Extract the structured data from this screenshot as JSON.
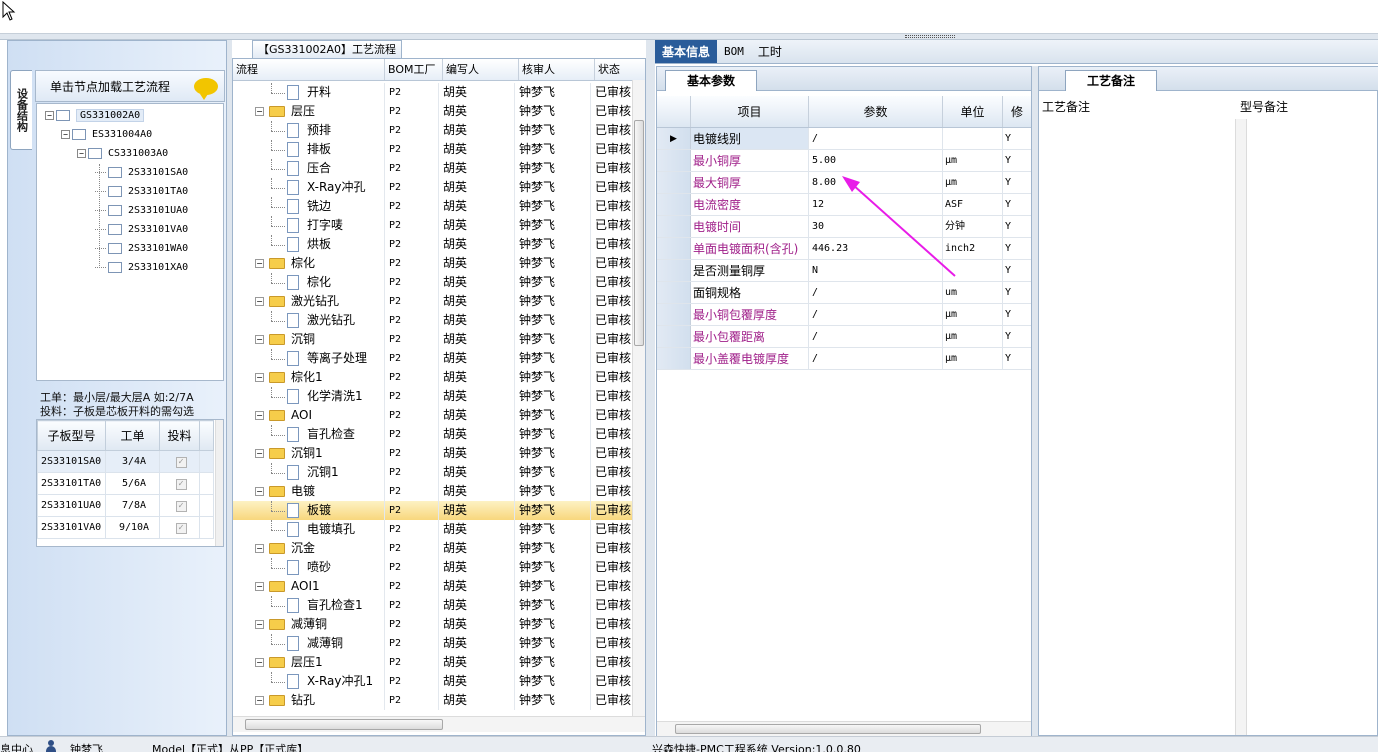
{
  "left": {
    "vtab": "设备结构",
    "header": "单击节点加载工艺流程",
    "tree": [
      {
        "label": "GS331002A0",
        "level": 0,
        "exp": true
      },
      {
        "label": "ES331004A0",
        "level": 1,
        "exp": true
      },
      {
        "label": "CS331003A0",
        "level": 2,
        "exp": true
      },
      {
        "label": "2S33101SA0",
        "level": 3
      },
      {
        "label": "2S33101TA0",
        "level": 3
      },
      {
        "label": "2S33101UA0",
        "level": 3
      },
      {
        "label": "2S33101VA0",
        "level": 3
      },
      {
        "label": "2S33101WA0",
        "level": 3
      },
      {
        "label": "2S33101XA0",
        "level": 3
      }
    ],
    "note1": "工单：最小层/最大层A 如:2/7A",
    "note2": "投料：子板是芯板开料的需勾选",
    "sub_grid": {
      "headers": [
        "子板型号",
        "工单",
        "投料"
      ],
      "rows": [
        [
          "2S33101SA0",
          "3/4A"
        ],
        [
          "2S33101TA0",
          "5/6A"
        ],
        [
          "2S33101UA0",
          "7/8A"
        ],
        [
          "2S33101VA0",
          "9/10A"
        ]
      ]
    }
  },
  "middle": {
    "title": "【GS331002A0】工艺流程",
    "headers": [
      "流程",
      "BOM工厂",
      "编写人",
      "核审人",
      "状态"
    ],
    "rows": [
      {
        "name": "开料",
        "type": "doc",
        "bom": "P2",
        "writer": "胡英",
        "checker": "钟梦飞",
        "status": "已审核"
      },
      {
        "name": "层压",
        "type": "folder",
        "bom": "P2",
        "writer": "胡英",
        "checker": "钟梦飞",
        "status": "已审核"
      },
      {
        "name": "预排",
        "type": "doc",
        "bom": "P2",
        "writer": "胡英",
        "checker": "钟梦飞",
        "status": "已审核"
      },
      {
        "name": "排板",
        "type": "doc",
        "bom": "P2",
        "writer": "胡英",
        "checker": "钟梦飞",
        "status": "已审核"
      },
      {
        "name": "压合",
        "type": "doc",
        "bom": "P2",
        "writer": "胡英",
        "checker": "钟梦飞",
        "status": "已审核"
      },
      {
        "name": "X-Ray冲孔",
        "type": "doc",
        "bom": "P2",
        "writer": "胡英",
        "checker": "钟梦飞",
        "status": "已审核"
      },
      {
        "name": "铣边",
        "type": "doc",
        "bom": "P2",
        "writer": "胡英",
        "checker": "钟梦飞",
        "status": "已审核"
      },
      {
        "name": "打字唛",
        "type": "doc",
        "bom": "P2",
        "writer": "胡英",
        "checker": "钟梦飞",
        "status": "已审核"
      },
      {
        "name": "烘板",
        "type": "doc",
        "bom": "P2",
        "writer": "胡英",
        "checker": "钟梦飞",
        "status": "已审核"
      },
      {
        "name": "棕化",
        "type": "folder",
        "bom": "P2",
        "writer": "胡英",
        "checker": "钟梦飞",
        "status": "已审核"
      },
      {
        "name": "棕化",
        "type": "doc",
        "bom": "P2",
        "writer": "胡英",
        "checker": "钟梦飞",
        "status": "已审核"
      },
      {
        "name": "激光钻孔",
        "type": "folder",
        "bom": "P2",
        "writer": "胡英",
        "checker": "钟梦飞",
        "status": "已审核"
      },
      {
        "name": "激光钻孔",
        "type": "doc",
        "bom": "P2",
        "writer": "胡英",
        "checker": "钟梦飞",
        "status": "已审核"
      },
      {
        "name": "沉铜",
        "type": "folder",
        "bom": "P2",
        "writer": "胡英",
        "checker": "钟梦飞",
        "status": "已审核"
      },
      {
        "name": "等离子处理",
        "type": "doc",
        "bom": "P2",
        "writer": "胡英",
        "checker": "钟梦飞",
        "status": "已审核"
      },
      {
        "name": "棕化1",
        "type": "folder",
        "bom": "P2",
        "writer": "胡英",
        "checker": "钟梦飞",
        "status": "已审核"
      },
      {
        "name": "化学清洗1",
        "type": "doc",
        "bom": "P2",
        "writer": "胡英",
        "checker": "钟梦飞",
        "status": "已审核"
      },
      {
        "name": "AOI",
        "type": "folder",
        "bom": "P2",
        "writer": "胡英",
        "checker": "钟梦飞",
        "status": "已审核"
      },
      {
        "name": "盲孔检查",
        "type": "doc",
        "bom": "P2",
        "writer": "胡英",
        "checker": "钟梦飞",
        "status": "已审核"
      },
      {
        "name": "沉铜1",
        "type": "folder",
        "bom": "P2",
        "writer": "胡英",
        "checker": "钟梦飞",
        "status": "已审核"
      },
      {
        "name": "沉铜1",
        "type": "doc",
        "bom": "P2",
        "writer": "胡英",
        "checker": "钟梦飞",
        "status": "已审核"
      },
      {
        "name": "电镀",
        "type": "folder",
        "bom": "P2",
        "writer": "胡英",
        "checker": "钟梦飞",
        "status": "已审核"
      },
      {
        "name": "板镀",
        "type": "doc",
        "bom": "P2",
        "writer": "胡英",
        "checker": "钟梦飞",
        "status": "已审核",
        "selected": true
      },
      {
        "name": "电镀填孔",
        "type": "doc",
        "bom": "P2",
        "writer": "胡英",
        "checker": "钟梦飞",
        "status": "已审核"
      },
      {
        "name": "沉金",
        "type": "folder",
        "bom": "P2",
        "writer": "胡英",
        "checker": "钟梦飞",
        "status": "已审核"
      },
      {
        "name": "喷砂",
        "type": "doc",
        "bom": "P2",
        "writer": "胡英",
        "checker": "钟梦飞",
        "status": "已审核"
      },
      {
        "name": "AOI1",
        "type": "folder",
        "bom": "P2",
        "writer": "胡英",
        "checker": "钟梦飞",
        "status": "已审核"
      },
      {
        "name": "盲孔检查1",
        "type": "doc",
        "bom": "P2",
        "writer": "胡英",
        "checker": "钟梦飞",
        "status": "已审核"
      },
      {
        "name": "减薄铜",
        "type": "folder",
        "bom": "P2",
        "writer": "胡英",
        "checker": "钟梦飞",
        "status": "已审核"
      },
      {
        "name": "减薄铜",
        "type": "doc",
        "bom": "P2",
        "writer": "胡英",
        "checker": "钟梦飞",
        "status": "已审核"
      },
      {
        "name": "层压1",
        "type": "folder",
        "bom": "P2",
        "writer": "胡英",
        "checker": "钟梦飞",
        "status": "已审核"
      },
      {
        "name": "X-Ray冲孔1",
        "type": "doc",
        "bom": "P2",
        "writer": "胡英",
        "checker": "钟梦飞",
        "status": "已审核"
      },
      {
        "name": "钻孔",
        "type": "folder",
        "bom": "P2",
        "writer": "胡英",
        "checker": "钟梦飞",
        "status": "已审核"
      }
    ]
  },
  "right": {
    "tabs": [
      "基本信息",
      "BOM",
      "工时"
    ],
    "basic_tab": "基本参数",
    "param_headers": [
      "项目",
      "参数",
      "单位",
      "修"
    ],
    "params": [
      {
        "item": "电镀线别",
        "value": "/",
        "unit": "",
        "flag": "Y",
        "color": "#000000",
        "current": true
      },
      {
        "item": "最小铜厚",
        "value": "5.00",
        "unit": "μm",
        "flag": "Y",
        "color": "#a0208a"
      },
      {
        "item": "最大铜厚",
        "value": "8.00",
        "unit": "μm",
        "flag": "Y",
        "color": "#a0208a"
      },
      {
        "item": "电流密度",
        "value": "12",
        "unit": "ASF",
        "flag": "Y",
        "color": "#a0208a"
      },
      {
        "item": "电镀时间",
        "value": "30",
        "unit": "分钟",
        "flag": "Y",
        "color": "#a0208a"
      },
      {
        "item": "单面电镀面积(含孔)",
        "value": "446.23",
        "unit": "inch2",
        "flag": "Y",
        "color": "#a0208a"
      },
      {
        "item": "是否测量铜厚",
        "value": "N",
        "unit": "",
        "flag": "Y",
        "color": "#000000"
      },
      {
        "item": "面铜规格",
        "value": "/",
        "unit": "um",
        "flag": "Y",
        "color": "#000000"
      },
      {
        "item": "最小铜包覆厚度",
        "value": "/",
        "unit": "μm",
        "flag": "Y",
        "color": "#a0208a"
      },
      {
        "item": "最小包覆距离",
        "value": "/",
        "unit": "μm",
        "flag": "Y",
        "color": "#a0208a"
      },
      {
        "item": "最小盖覆电镀厚度",
        "value": "/",
        "unit": "μm",
        "flag": "Y",
        "color": "#a0208a"
      }
    ],
    "remark_tab": "工艺备注",
    "remark_headers": [
      "工艺备注",
      "型号备注"
    ]
  },
  "status_bar": {
    "left": "息中心",
    "user": "钟梦飞",
    "mid": "Model【正式】从PP【正式库】",
    "right": "兴森快捷-PMC工程系统 Version:1.0.0.80"
  },
  "colors": {
    "accent": "#2a5c9a",
    "annotation_arrow": "#e81ce8"
  }
}
